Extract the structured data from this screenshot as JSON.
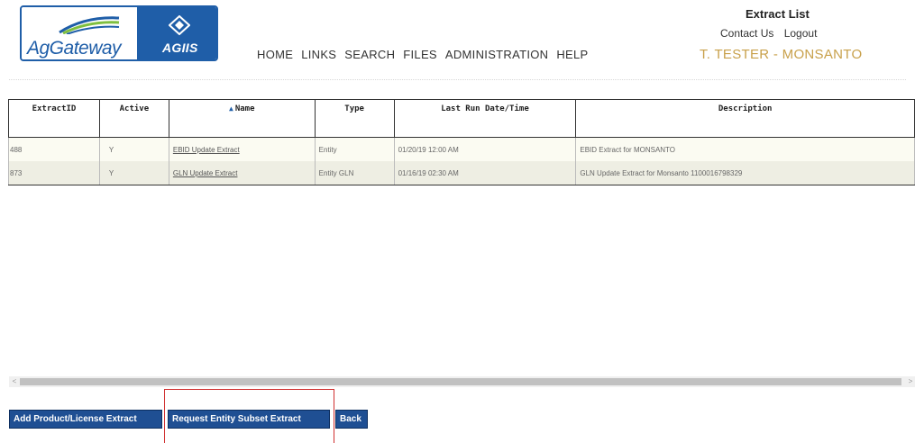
{
  "logo": {
    "left_text": "AgGateway",
    "right_text": "AGIIS"
  },
  "nav": [
    "HOME",
    "LINKS",
    "SEARCH",
    "FILES",
    "ADMINISTRATION",
    "HELP"
  ],
  "top_right": {
    "title": "Extract List",
    "contact": "Contact Us",
    "logout": "Logout",
    "user": "T. TESTER - MONSANTO"
  },
  "table": {
    "headers": {
      "id": "ExtractID",
      "active": "Active",
      "name": "Name",
      "type": "Type",
      "date": "Last Run Date/Time",
      "desc": "Description"
    },
    "sort_indicator": "▲",
    "rows": [
      {
        "id": "488",
        "active": "Y",
        "name": "EBID Update Extract",
        "type": "Entity",
        "date": "01/20/19 12:00 AM",
        "desc": "EBID Extract for MONSANTO"
      },
      {
        "id": "873",
        "active": "Y",
        "name": "GLN Update Extract",
        "type": "Entity GLN",
        "date": "01/16/19 02:30 AM",
        "desc": "GLN Update Extract for Monsanto 1100016798329"
      }
    ]
  },
  "scrollbar": {
    "left_arrow": "<",
    "right_arrow": ">"
  },
  "buttons": {
    "add": "Add Product/License Extract",
    "request": "Request Entity Subset Extract",
    "back": "Back"
  }
}
